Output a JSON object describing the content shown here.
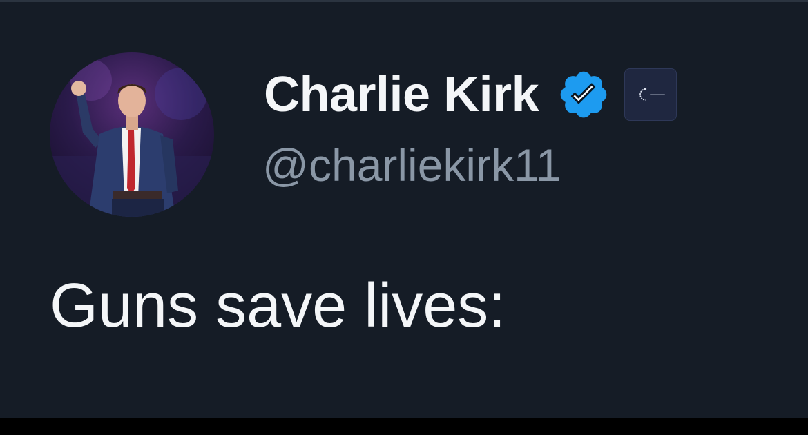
{
  "tweet": {
    "author": {
      "display_name": "Charlie Kirk",
      "handle": "@charliekirk11",
      "verified_icon": "verified-badge-icon",
      "affiliate_icon": "affiliate-organization-icon",
      "avatar_icon": "profile-photo"
    },
    "text": "Guns save lives:"
  },
  "colors": {
    "background": "#151c26",
    "name_text": "#f4f6f8",
    "handle_text": "#8a97a6",
    "verified_blue": "#1d9bf0"
  }
}
